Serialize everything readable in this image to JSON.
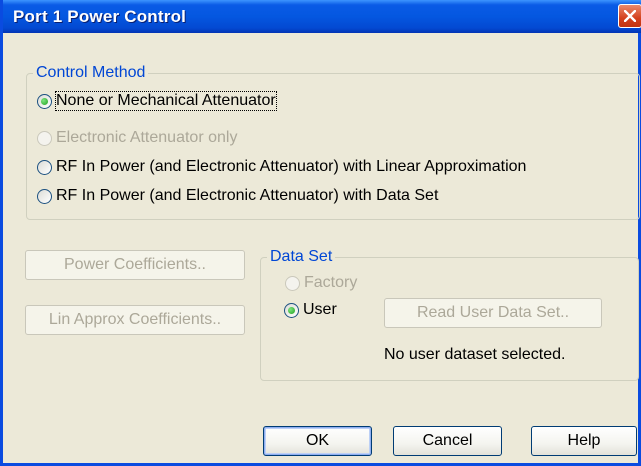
{
  "window": {
    "title": "Port 1 Power Control"
  },
  "control_method": {
    "legend": "Control Method",
    "options": [
      {
        "label": "None or Mechanical Attenuator",
        "checked": true,
        "enabled": true
      },
      {
        "label": "Electronic Attenuator only",
        "checked": false,
        "enabled": false
      },
      {
        "label": "RF In Power (and Electronic Attenuator) with Linear Approximation",
        "checked": false,
        "enabled": true
      },
      {
        "label": "RF In Power (and Electronic Attenuator) with Data Set",
        "checked": false,
        "enabled": true
      }
    ]
  },
  "buttons": {
    "power_coefficients": "Power Coefficients..",
    "lin_approx_coefficients": "Lin Approx Coefficients..",
    "read_user_data_set": "Read User Data Set..",
    "ok": "OK",
    "cancel": "Cancel",
    "help": "Help"
  },
  "data_set": {
    "legend": "Data Set",
    "options": [
      {
        "label": "Factory",
        "checked": false,
        "enabled": false
      },
      {
        "label": "User",
        "checked": true,
        "enabled": true
      }
    ],
    "status": "No user dataset selected."
  },
  "colors": {
    "title_bar": "#0457e0",
    "group_label": "#0046d5",
    "disabled_text": "#aca899",
    "dialog_face": "#ece9d8"
  }
}
